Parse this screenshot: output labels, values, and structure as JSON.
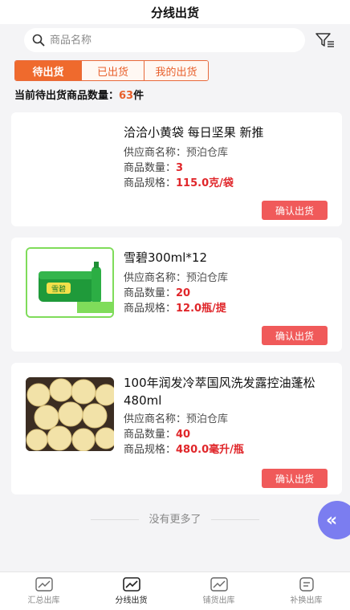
{
  "header": {
    "title": "分线出货"
  },
  "search": {
    "placeholder": "商品名称"
  },
  "tabs": [
    {
      "label": "待出货",
      "active": true
    },
    {
      "label": "已出货",
      "active": false
    },
    {
      "label": "我的出货",
      "active": false
    }
  ],
  "summary": {
    "label": "当前待出货商品数量：",
    "count": "63",
    "unit": "件"
  },
  "products": [
    {
      "name": "洽洽小黄袋 每日坚果 新推",
      "supplier_label": "供应商名称：",
      "supplier": "预泊仓库",
      "qty_label": "商品数量：",
      "qty": "3",
      "spec_label": "商品规格：",
      "spec": "115.0克/袋",
      "button": "确认出货",
      "image": "none"
    },
    {
      "name": "雪碧300ml*12",
      "supplier_label": "供应商名称：",
      "supplier": "预泊仓库",
      "qty_label": "商品数量：",
      "qty": "20",
      "spec_label": "商品规格：",
      "spec": "12.0瓶/提",
      "button": "确认出货",
      "image": "sprite-pack",
      "image_text": "雪碧"
    },
    {
      "name": "100年润发冷萃国风洗发露控油蓬松480ml",
      "supplier_label": "供应商名称：",
      "supplier": "预泊仓库",
      "qty_label": "商品数量：",
      "qty": "40",
      "spec_label": "商品规格：",
      "spec": "480.0毫升/瓶",
      "button": "确认出货",
      "image": "pears"
    }
  ],
  "footer_text": "没有更多了",
  "float_button": {
    "icon": "double-chevron-left-icon",
    "glyph": "«"
  },
  "bottom_nav": [
    {
      "label": "汇总出库",
      "icon": "chart-icon",
      "active": false
    },
    {
      "label": "分线出货",
      "icon": "chart-icon",
      "active": true
    },
    {
      "label": "铺货出库",
      "icon": "chart-icon",
      "active": false
    },
    {
      "label": "补换出库",
      "icon": "document-icon",
      "active": false
    }
  ],
  "colors": {
    "accent": "#ef6a2d",
    "button_red": "#f05a5a",
    "value_red": "#e0262a",
    "float": "#7b7df0"
  }
}
